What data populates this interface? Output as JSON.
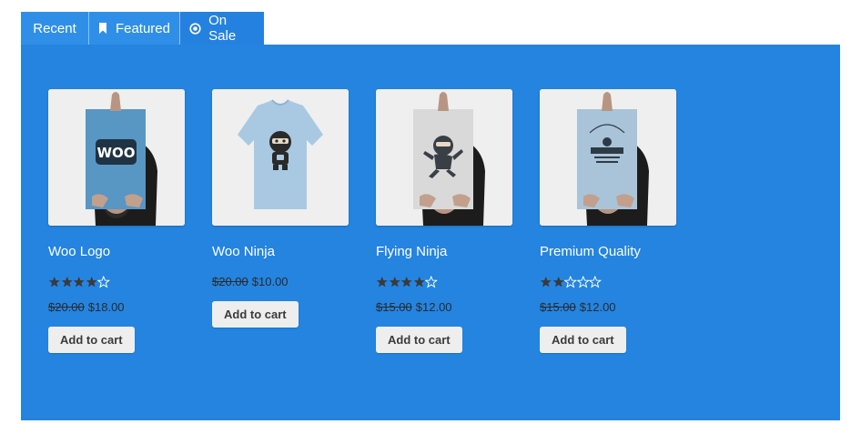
{
  "tabs": [
    {
      "label": "Recent",
      "icon": "",
      "active": false
    },
    {
      "label": "Featured",
      "icon": "bookmark-icon",
      "active": false
    },
    {
      "label": "On Sale",
      "icon": "radio-dot-icon",
      "active": true
    }
  ],
  "colors": {
    "panel": "#2484e0",
    "tab": "#2f8fe8",
    "active_tab": "#2481e0",
    "star": "#3a3a3a"
  },
  "products": [
    {
      "name": "Woo Logo",
      "image": "poster-woo-logo",
      "rating": 4,
      "rating_max": 5,
      "regular_price": "$20.00",
      "sale_price": "$18.00",
      "button": "Add to cart"
    },
    {
      "name": "Woo Ninja",
      "image": "tshirt-woo-ninja",
      "rating": null,
      "rating_max": 5,
      "regular_price": "$20.00",
      "sale_price": "$10.00",
      "button": "Add to cart"
    },
    {
      "name": "Flying Ninja",
      "image": "poster-flying-ninja",
      "rating": 4,
      "rating_max": 5,
      "regular_price": "$15.00",
      "sale_price": "$12.00",
      "button": "Add to cart"
    },
    {
      "name": "Premium Quality",
      "image": "poster-premium-quality",
      "rating": 2,
      "rating_max": 5,
      "regular_price": "$15.00",
      "sale_price": "$12.00",
      "button": "Add to cart"
    }
  ]
}
